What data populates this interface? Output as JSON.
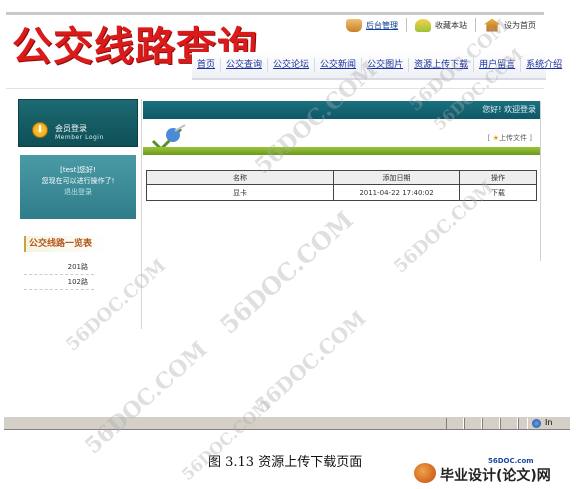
{
  "header": {
    "logo_text": "公交线路查询",
    "util_links": [
      {
        "label": "后台管理",
        "icon": "phone-icon"
      },
      {
        "label": "收藏本站",
        "icon": "favorite-icon"
      },
      {
        "label": "设为首页",
        "icon": "home-icon"
      }
    ]
  },
  "nav": {
    "items": [
      "首页",
      "公交查询",
      "公交论坛",
      "公交新闻",
      "公交图片",
      "资源上传下载",
      "用户留言",
      "系统介绍"
    ]
  },
  "sidebar": {
    "login_title": "会员登录",
    "login_subtitle": "Member Login",
    "welcome_line1": "[test]您好!",
    "welcome_line2": "您现在可以进行操作了!",
    "logout_label": "退出登录",
    "routes_title": "公交线路一览表",
    "routes": [
      "201路",
      "102路"
    ]
  },
  "main": {
    "greeting": "您好! 欢迎登录",
    "upload_label": "上传文件",
    "table": {
      "columns": [
        "名称",
        "添加日期",
        "操作"
      ],
      "rows": [
        {
          "name": "显卡",
          "date": "2011-04-22 17:40:02",
          "action": "下载"
        }
      ]
    }
  },
  "statusbar": {
    "zone_text": "In"
  },
  "caption": "图 3.13 资源上传下载页面",
  "brand": {
    "url": "56DOC.com",
    "name": "毕业设计(论文)网"
  },
  "watermarks": [
    "56DOC.COM",
    "56DOC.COM",
    "56DOC.COM",
    "56DOC.COM",
    "56DOC.COM",
    "56DOC.COM",
    "56DOC.COM",
    "56DOC.COM",
    "56DOC.COM"
  ],
  "colors": {
    "logo_red": "#dd1a1a",
    "teal": "#0f5867",
    "green_bar": "#7fae28",
    "nav_link": "#1a2f9a"
  }
}
